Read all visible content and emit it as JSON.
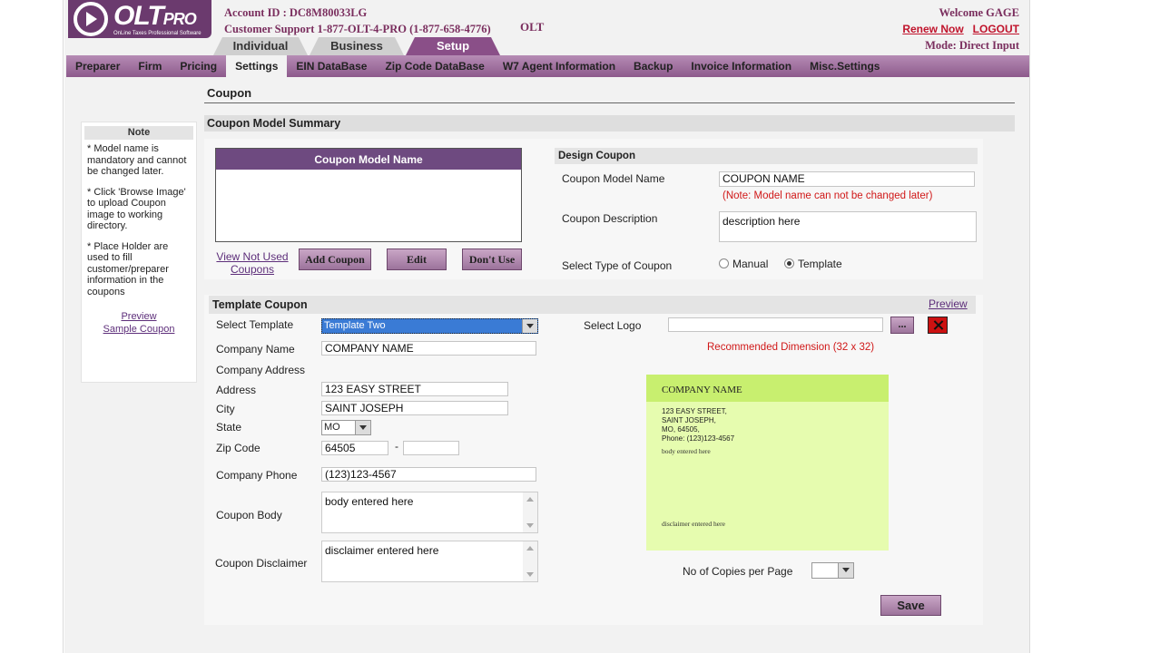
{
  "header": {
    "logo_text": "OLT",
    "logo_text_suffix": "PRO",
    "logo_subtitle": "OnLine Taxes Professional Software",
    "account_id": "Account ID : DC8M80033LG",
    "customer_support": "Customer Support 1-877-OLT-4-PRO (1-877-658-4776)",
    "olt_label": "OLT",
    "welcome": "Welcome GAGE",
    "renew_now": "Renew Now",
    "logout": "LOGOUT",
    "mode": "Mode: Direct Input"
  },
  "main_tabs": [
    {
      "label": "Individual",
      "active": false
    },
    {
      "label": "Business",
      "active": false
    },
    {
      "label": "Setup",
      "active": true
    }
  ],
  "sub_nav": [
    {
      "label": "Preparer",
      "active": false
    },
    {
      "label": "Firm",
      "active": false
    },
    {
      "label": "Pricing",
      "active": false
    },
    {
      "label": "Settings",
      "active": true
    },
    {
      "label": "EIN DataBase",
      "active": false
    },
    {
      "label": "Zip Code DataBase",
      "active": false
    },
    {
      "label": "W7 Agent Information",
      "active": false
    },
    {
      "label": "Backup",
      "active": false
    },
    {
      "label": "Invoice Information",
      "active": false
    },
    {
      "label": "Misc.Settings",
      "active": false
    }
  ],
  "page_title": "Coupon",
  "note": {
    "title": "Note",
    "items": [
      "* Model name is mandatory and cannot be changed later.",
      "* Click 'Browse Image' to upload Coupon image to working directory.",
      "* Place Holder are used to fill customer/preparer information in the coupons"
    ],
    "preview_link_1": "Preview",
    "preview_link_2": "Sample Coupon"
  },
  "summary": {
    "title": "Coupon Model Summary",
    "list_header": "Coupon Model Name",
    "view_not_used_1": "View Not Used",
    "view_not_used_2": "Coupons",
    "add_button": "Add Coupon",
    "edit_button": "Edit",
    "dont_use_button": "Don't Use"
  },
  "design": {
    "title": "Design Coupon",
    "model_name_label": "Coupon Model Name",
    "model_name_value": "COUPON NAME",
    "model_name_note": "(Note: Model name can not be changed later)",
    "description_label": "Coupon Description",
    "description_value": "description here",
    "type_label": "Select Type of Coupon",
    "type_manual": "Manual",
    "type_template": "Template",
    "type_selected": "Template"
  },
  "template": {
    "title": "Template Coupon",
    "preview_link": "Preview",
    "select_template_label": "Select Template",
    "select_template_value": "Template Two",
    "company_name_label": "Company Name",
    "company_name_value": "COMPANY NAME",
    "company_address_label": "Company Address",
    "address_label": "Address",
    "address_value": "123 EASY STREET",
    "city_label": "City",
    "city_value": "SAINT JOSEPH",
    "state_label": "State",
    "state_value": "MO",
    "zip_label": "Zip Code",
    "zip_value": "64505",
    "zip_dash": "-",
    "zip_ext_value": "",
    "phone_label": "Company Phone",
    "phone_value": "(123)123-4567",
    "body_label": "Coupon Body",
    "body_value": "body entered here",
    "disclaimer_label": "Coupon Disclaimer",
    "disclaimer_value": "disclaimer entered here",
    "select_logo_label": "Select Logo",
    "select_logo_value": "",
    "browse_button": "...",
    "recommended_dimension": "Recommended Dimension (32 x 32)",
    "copies_label": "No of Copies per Page",
    "copies_value": "",
    "save_button": "Save"
  },
  "preview_card": {
    "company": "COMPANY NAME",
    "line1": "123 EASY STREET,",
    "line2": "SAINT JOSEPH,",
    "line3": "MO, 64505,",
    "line4": "Phone: (123)123-4567",
    "body": "body entered here",
    "disclaimer": "disclaimer entered here"
  },
  "colors": {
    "brand_purple": "#6b3a6e",
    "nav_gradient_top": "#b68cb5",
    "alert_red": "#d01818",
    "preview_green": "#e6fcaf"
  }
}
